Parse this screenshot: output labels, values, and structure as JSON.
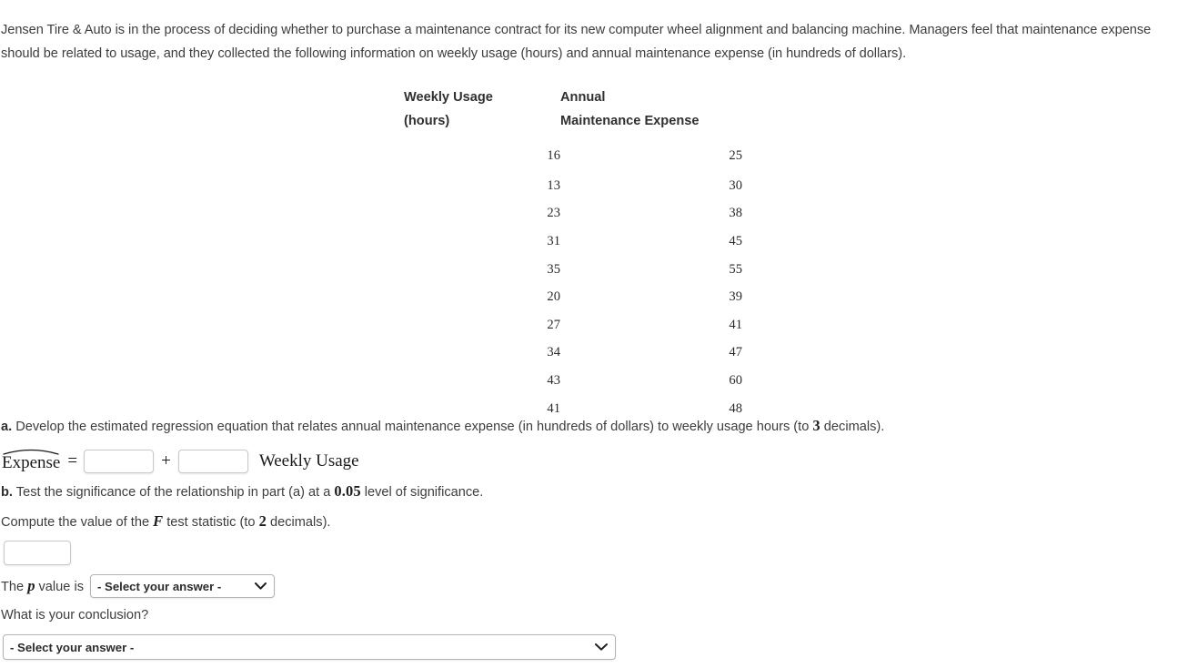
{
  "intro": {
    "text": "Jensen Tire & Auto is in the process of deciding whether to purchase a maintenance contract for its new computer wheel alignment and balancing machine. Managers feel that maintenance expense should be related to usage, and they collected the following information on weekly usage (hours) and annual maintenance expense (in hundreds of dollars)."
  },
  "table": {
    "headers": {
      "col_a_line1": "Weekly Usage",
      "col_a_line2": "(hours)",
      "col_b_line1": "Annual",
      "col_b_line2": "Maintenance Expense"
    },
    "rows": [
      {
        "weekly_usage": "16",
        "annual_maintenance_expense": "25"
      },
      {
        "weekly_usage": "13",
        "annual_maintenance_expense": "30"
      },
      {
        "weekly_usage": "23",
        "annual_maintenance_expense": "38"
      },
      {
        "weekly_usage": "31",
        "annual_maintenance_expense": "45"
      },
      {
        "weekly_usage": "35",
        "annual_maintenance_expense": "55"
      },
      {
        "weekly_usage": "20",
        "annual_maintenance_expense": "39"
      },
      {
        "weekly_usage": "27",
        "annual_maintenance_expense": "41"
      },
      {
        "weekly_usage": "34",
        "annual_maintenance_expense": "47"
      },
      {
        "weekly_usage": "43",
        "annual_maintenance_expense": "60"
      },
      {
        "weekly_usage": "41",
        "annual_maintenance_expense": "48"
      }
    ]
  },
  "part_a": {
    "label": "a.",
    "text_before": " Develop the estimated regression equation that relates annual maintenance expense (in hundreds of dollars) to weekly usage hours (to ",
    "decimals": "3",
    "text_after": " decimals).",
    "equation": {
      "lhs": "Expense",
      "equals": "=",
      "intercept_value": "",
      "intercept_placeholder": "",
      "plus": "+",
      "slope_value": "",
      "slope_placeholder": "",
      "tail": "Weekly Usage"
    }
  },
  "part_b": {
    "label": "b.",
    "text_before": " Test the significance of the relationship in part (a) at a ",
    "alpha": "0.05",
    "text_after": " level of significance.",
    "compute_before": "Compute the value of the ",
    "statistic_symbol": "F",
    "compute_after": " test statistic (to ",
    "compute_decimals": "2",
    "compute_end": " decimals).",
    "f_value": "",
    "f_placeholder": ""
  },
  "p_value_row": {
    "lead_before": "The ",
    "symbol": "p",
    "lead_after": " value is",
    "select_value": "- Select your answer -",
    "chevron_icon": "chevron-down-icon"
  },
  "conclusion": {
    "question": "What is your conclusion?",
    "select_value": "- Select your answer -",
    "chevron_icon": "chevron-down-icon"
  },
  "colors": {
    "text": "#3d3d3d",
    "heading": "#2f2f2f",
    "border": "#c9c9c9",
    "background": "#ffffff"
  }
}
